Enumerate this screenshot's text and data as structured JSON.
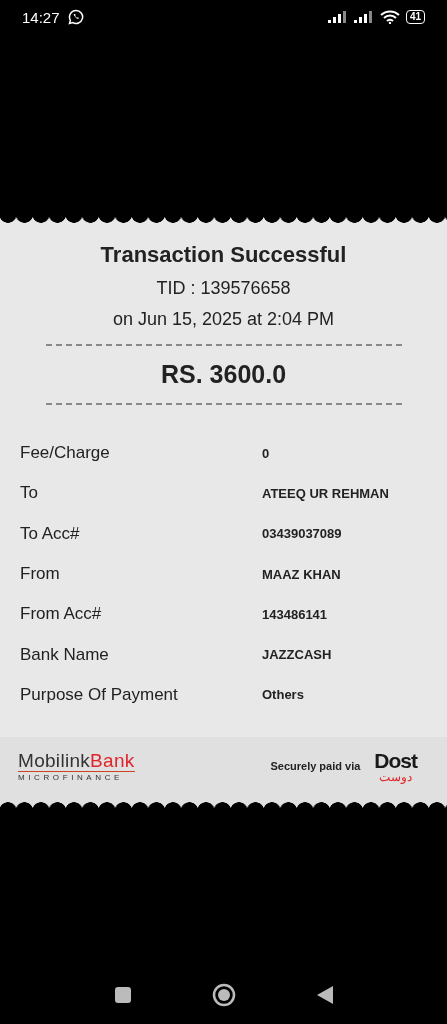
{
  "status_bar": {
    "time": "14:27",
    "battery": "41"
  },
  "receipt": {
    "title": "Transaction Successful",
    "tid": "TID : 139576658",
    "date": "on Jun 15, 2025 at 2:04 PM",
    "amount": "RS. 3600.0",
    "details": [
      {
        "label": "Fee/Charge",
        "value": "0"
      },
      {
        "label": "To",
        "value": "ATEEQ UR REHMAN"
      },
      {
        "label": "To Acc#",
        "value": "03439037089"
      },
      {
        "label": "From",
        "value": "MAAZ KHAN"
      },
      {
        "label": "From Acc#",
        "value": "143486141"
      },
      {
        "label": "Bank Name",
        "value": "JAZZCASH"
      },
      {
        "label": "Purpose Of Payment",
        "value": "Others"
      }
    ]
  },
  "footer": {
    "bank_logo": {
      "part_1": "Mobilink",
      "part_2": "Bank",
      "tagline": "MICROFINANCE"
    },
    "secured_text": "Securely paid via",
    "partner_logo": {
      "latin": "Dost",
      "urdu": "دوست"
    }
  }
}
